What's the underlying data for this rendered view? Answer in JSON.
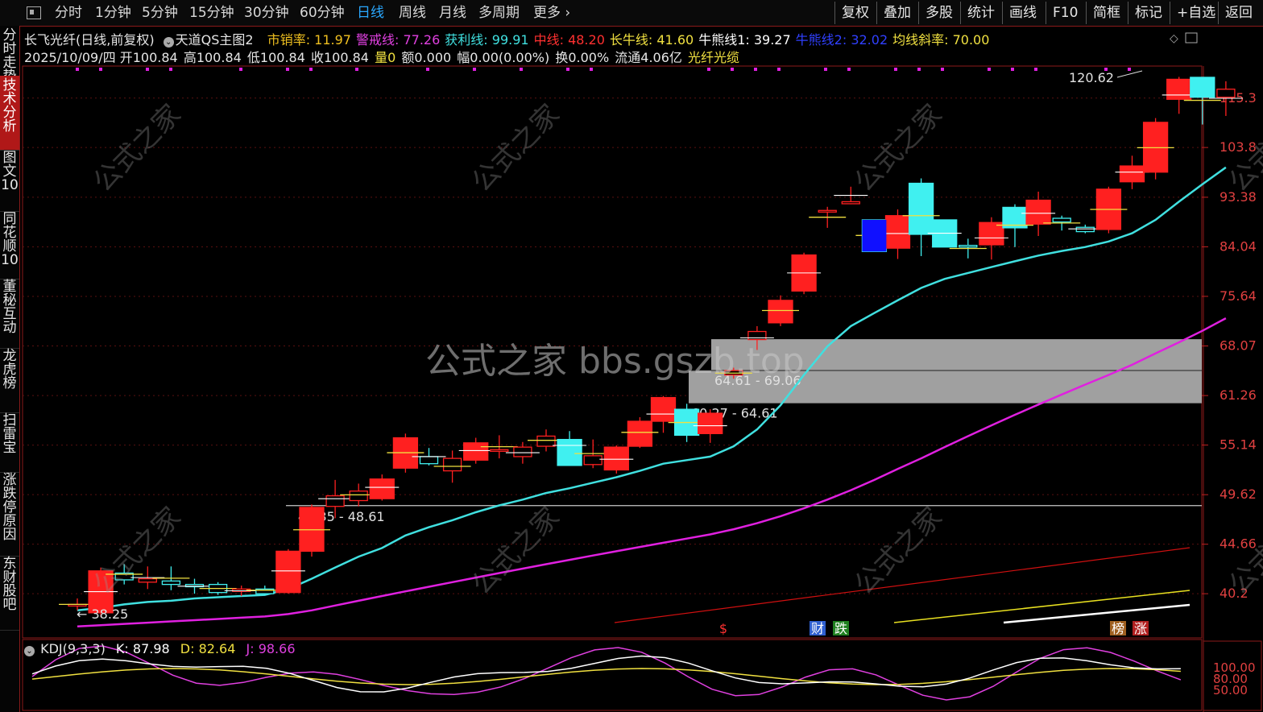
{
  "toolbar": {
    "periods": [
      "分时",
      "1分钟",
      "5分钟",
      "15分钟",
      "30分钟",
      "60分钟",
      "日线",
      "周线",
      "月线",
      "多周期",
      "更多"
    ],
    "active_period": "日线",
    "right_buttons": [
      "复权",
      "叠加",
      "多股",
      "统计",
      "画线",
      "F10",
      "简框",
      "标记",
      "+自选",
      "返回"
    ]
  },
  "sidebar": {
    "items": [
      "分时走势",
      "技术分析",
      "图文10",
      "同花顺10",
      "董秘互动",
      "龙虎榜",
      "扫雷宝",
      "涨跌停原因",
      "东财股吧"
    ],
    "active": "技术分析"
  },
  "header": {
    "stock": "长飞光纤(日线,前复权)",
    "indicator": "天道QS主图2",
    "params": [
      {
        "label": "市销率",
        "value": "11.97",
        "color": "#f0c020"
      },
      {
        "label": "警戒线",
        "value": "77.26",
        "color": "#e040e0"
      },
      {
        "label": "获利线",
        "value": "99.91",
        "color": "#40e0e0"
      },
      {
        "label": "中线",
        "value": "48.20",
        "color": "#ff3030"
      },
      {
        "label": "长牛线",
        "value": "41.60",
        "color": "#f0e040"
      },
      {
        "label": "牛熊线1",
        "value": "39.27",
        "color": "#ffffff"
      },
      {
        "label": "牛熊线2",
        "value": "32.02",
        "color": "#3040ff"
      },
      {
        "label": "均线斜率",
        "value": "70.00",
        "color": "#f0e040"
      }
    ],
    "date": "2025/10/09/四",
    "open": "开100.84",
    "high": "高100.84",
    "low": "低100.84",
    "close": "收100.84",
    "vol": "量0",
    "amount": "额0.000",
    "change": "幅0.00(0.00%)",
    "turnover": "换0.00%",
    "float": "流通4.06亿",
    "concept": "光纤光缆"
  },
  "kdj": {
    "label": "KDJ(9,3,3)",
    "k": "K: 87.98",
    "d": "D: 82.64",
    "j": "J: 98.66"
  },
  "watermark": "公式之家 bbs.gszb.top",
  "chart_data": {
    "type": "candlestick",
    "y_axis_ticks": [
      115.3,
      103.8,
      93.38,
      84.04,
      75.64,
      68.07,
      61.26,
      55.14,
      49.62,
      44.66,
      40.2
    ],
    "kdj_ticks": [
      "100.00",
      "80.00",
      "50.00"
    ],
    "annotations": [
      "120.62",
      "38.25",
      "48.35 - 48.61",
      "60.27 - 64.61",
      "64.61 - 69.06"
    ],
    "markers": [
      "$",
      "财",
      "跌",
      "榜",
      "涨"
    ],
    "colors": {
      "up": "#ff2020",
      "down": "#40f0f0",
      "ma_short": "#40e0e0",
      "ma_long": "#e020e0",
      "red_line": "#d01010",
      "yellow_line": "#e8e020",
      "white_line": "#ffffff"
    },
    "candles": [
      {
        "o": 39.3,
        "h": 39.8,
        "l": 38.8,
        "c": 39.3
      },
      {
        "o": 38.6,
        "h": 42.5,
        "l": 38.25,
        "c": 42.2
      },
      {
        "o": 42.0,
        "h": 42.8,
        "l": 41.0,
        "c": 41.4
      },
      {
        "o": 41.2,
        "h": 42.6,
        "l": 40.6,
        "c": 41.5
      },
      {
        "o": 41.3,
        "h": 42.6,
        "l": 40.5,
        "c": 41.0
      },
      {
        "o": 41.0,
        "h": 41.5,
        "l": 40.2,
        "c": 40.8
      },
      {
        "o": 41.0,
        "h": 41.2,
        "l": 40.1,
        "c": 40.3
      },
      {
        "o": 40.4,
        "h": 40.9,
        "l": 40.0,
        "c": 40.6
      },
      {
        "o": 40.6,
        "h": 40.9,
        "l": 40.1,
        "c": 40.2
      },
      {
        "o": 40.3,
        "h": 44.2,
        "l": 40.2,
        "c": 44.0
      },
      {
        "o": 44.0,
        "h": 48.6,
        "l": 43.5,
        "c": 48.3
      },
      {
        "o": 48.4,
        "h": 51.2,
        "l": 47.2,
        "c": 49.5
      },
      {
        "o": 49.0,
        "h": 50.8,
        "l": 48.4,
        "c": 50.0
      },
      {
        "o": 49.2,
        "h": 51.8,
        "l": 49.0,
        "c": 51.3
      },
      {
        "o": 52.5,
        "h": 56.5,
        "l": 52.0,
        "c": 56.0
      },
      {
        "o": 53.8,
        "h": 54.8,
        "l": 52.8,
        "c": 53.0
      },
      {
        "o": 52.2,
        "h": 54.5,
        "l": 50.9,
        "c": 53.6
      },
      {
        "o": 53.4,
        "h": 56.0,
        "l": 53.0,
        "c": 55.4
      },
      {
        "o": 54.5,
        "h": 56.3,
        "l": 53.6,
        "c": 54.6
      },
      {
        "o": 53.8,
        "h": 55.5,
        "l": 53.0,
        "c": 54.9
      },
      {
        "o": 55.0,
        "h": 57.0,
        "l": 54.4,
        "c": 56.2
      },
      {
        "o": 55.8,
        "h": 56.8,
        "l": 53.4,
        "c": 52.8
      },
      {
        "o": 52.9,
        "h": 55.8,
        "l": 52.5,
        "c": 53.9
      },
      {
        "o": 52.3,
        "h": 55.1,
        "l": 51.9,
        "c": 54.9
      },
      {
        "o": 55.0,
        "h": 58.5,
        "l": 54.8,
        "c": 58.0
      },
      {
        "o": 58.0,
        "h": 61.2,
        "l": 56.6,
        "c": 61.0
      },
      {
        "o": 59.5,
        "h": 60.2,
        "l": 55.5,
        "c": 56.3
      },
      {
        "o": 56.5,
        "h": 59.5,
        "l": 55.4,
        "c": 59.0
      },
      {
        "o": 64.0,
        "h": 65.0,
        "l": 63.5,
        "c": 64.6
      },
      {
        "o": 69.0,
        "h": 71.0,
        "l": 67.5,
        "c": 70.2
      },
      {
        "o": 71.5,
        "h": 75.8,
        "l": 71.0,
        "c": 75.0
      },
      {
        "o": 76.5,
        "h": 83.0,
        "l": 76.0,
        "c": 82.6
      },
      {
        "o": 90.8,
        "h": 91.5,
        "l": 87.5,
        "c": 90.8
      },
      {
        "o": 92.1,
        "h": 95.5,
        "l": 92.0,
        "c": 92.5
      },
      {
        "o": 89.0,
        "h": 89.0,
        "l": 83.2,
        "c": 83.2
      },
      {
        "o": 83.8,
        "h": 91.0,
        "l": 81.9,
        "c": 89.8
      },
      {
        "o": 96.2,
        "h": 97.2,
        "l": 82.4,
        "c": 86.3
      },
      {
        "o": 89.0,
        "h": 89.0,
        "l": 84.0,
        "c": 84.0
      },
      {
        "o": 84.3,
        "h": 85.5,
        "l": 82.0,
        "c": 84.0
      },
      {
        "o": 84.4,
        "h": 89.5,
        "l": 81.8,
        "c": 88.5
      },
      {
        "o": 91.4,
        "h": 92.0,
        "l": 84.0,
        "c": 87.5
      },
      {
        "o": 88.2,
        "h": 94.5,
        "l": 86.0,
        "c": 92.8
      },
      {
        "o": 89.3,
        "h": 89.8,
        "l": 87.0,
        "c": 88.6
      },
      {
        "o": 87.6,
        "h": 88.1,
        "l": 86.5,
        "c": 86.8
      },
      {
        "o": 87.2,
        "h": 95.5,
        "l": 86.5,
        "c": 95.0
      },
      {
        "o": 96.5,
        "h": 102.0,
        "l": 95.0,
        "c": 99.8
      },
      {
        "o": 98.5,
        "h": 110.5,
        "l": 97.0,
        "c": 109.5
      },
      {
        "o": 115.0,
        "h": 120.62,
        "l": 111.5,
        "c": 120.0
      },
      {
        "o": 120.5,
        "h": 120.5,
        "l": 109.0,
        "c": 115.5
      },
      {
        "o": 115.5,
        "h": 119.5,
        "l": 111.0,
        "c": 117.5
      }
    ],
    "ma_short": [
      38.8,
      39.0,
      39.3,
      39.5,
      39.6,
      39.8,
      39.9,
      40.0,
      40.1,
      40.6,
      41.5,
      42.5,
      43.5,
      44.3,
      45.5,
      46.3,
      47.0,
      47.8,
      48.5,
      49.1,
      49.8,
      50.3,
      50.9,
      51.5,
      52.2,
      53.0,
      53.4,
      53.8,
      55.0,
      57.0,
      60.0,
      64.0,
      68.0,
      71.0,
      73.0,
      75.0,
      77.0,
      78.5,
      79.5,
      80.5,
      81.5,
      82.5,
      83.3,
      84.0,
      85.0,
      86.5,
      89.0,
      92.5,
      96.0,
      99.5
    ],
    "ma_long": [
      37.5,
      37.6,
      37.7,
      37.8,
      37.9,
      38.0,
      38.1,
      38.2,
      38.3,
      38.5,
      38.8,
      39.2,
      39.6,
      40.0,
      40.4,
      40.8,
      41.2,
      41.6,
      42.0,
      42.4,
      42.8,
      43.2,
      43.6,
      44.0,
      44.4,
      44.8,
      45.2,
      45.6,
      46.1,
      46.7,
      47.4,
      48.2,
      49.1,
      50.1,
      51.2,
      52.4,
      53.6,
      54.9,
      56.2,
      57.5,
      58.8,
      60.1,
      61.4,
      62.7,
      64.0,
      65.4,
      67.0,
      68.6,
      70.3,
      72.2
    ]
  }
}
